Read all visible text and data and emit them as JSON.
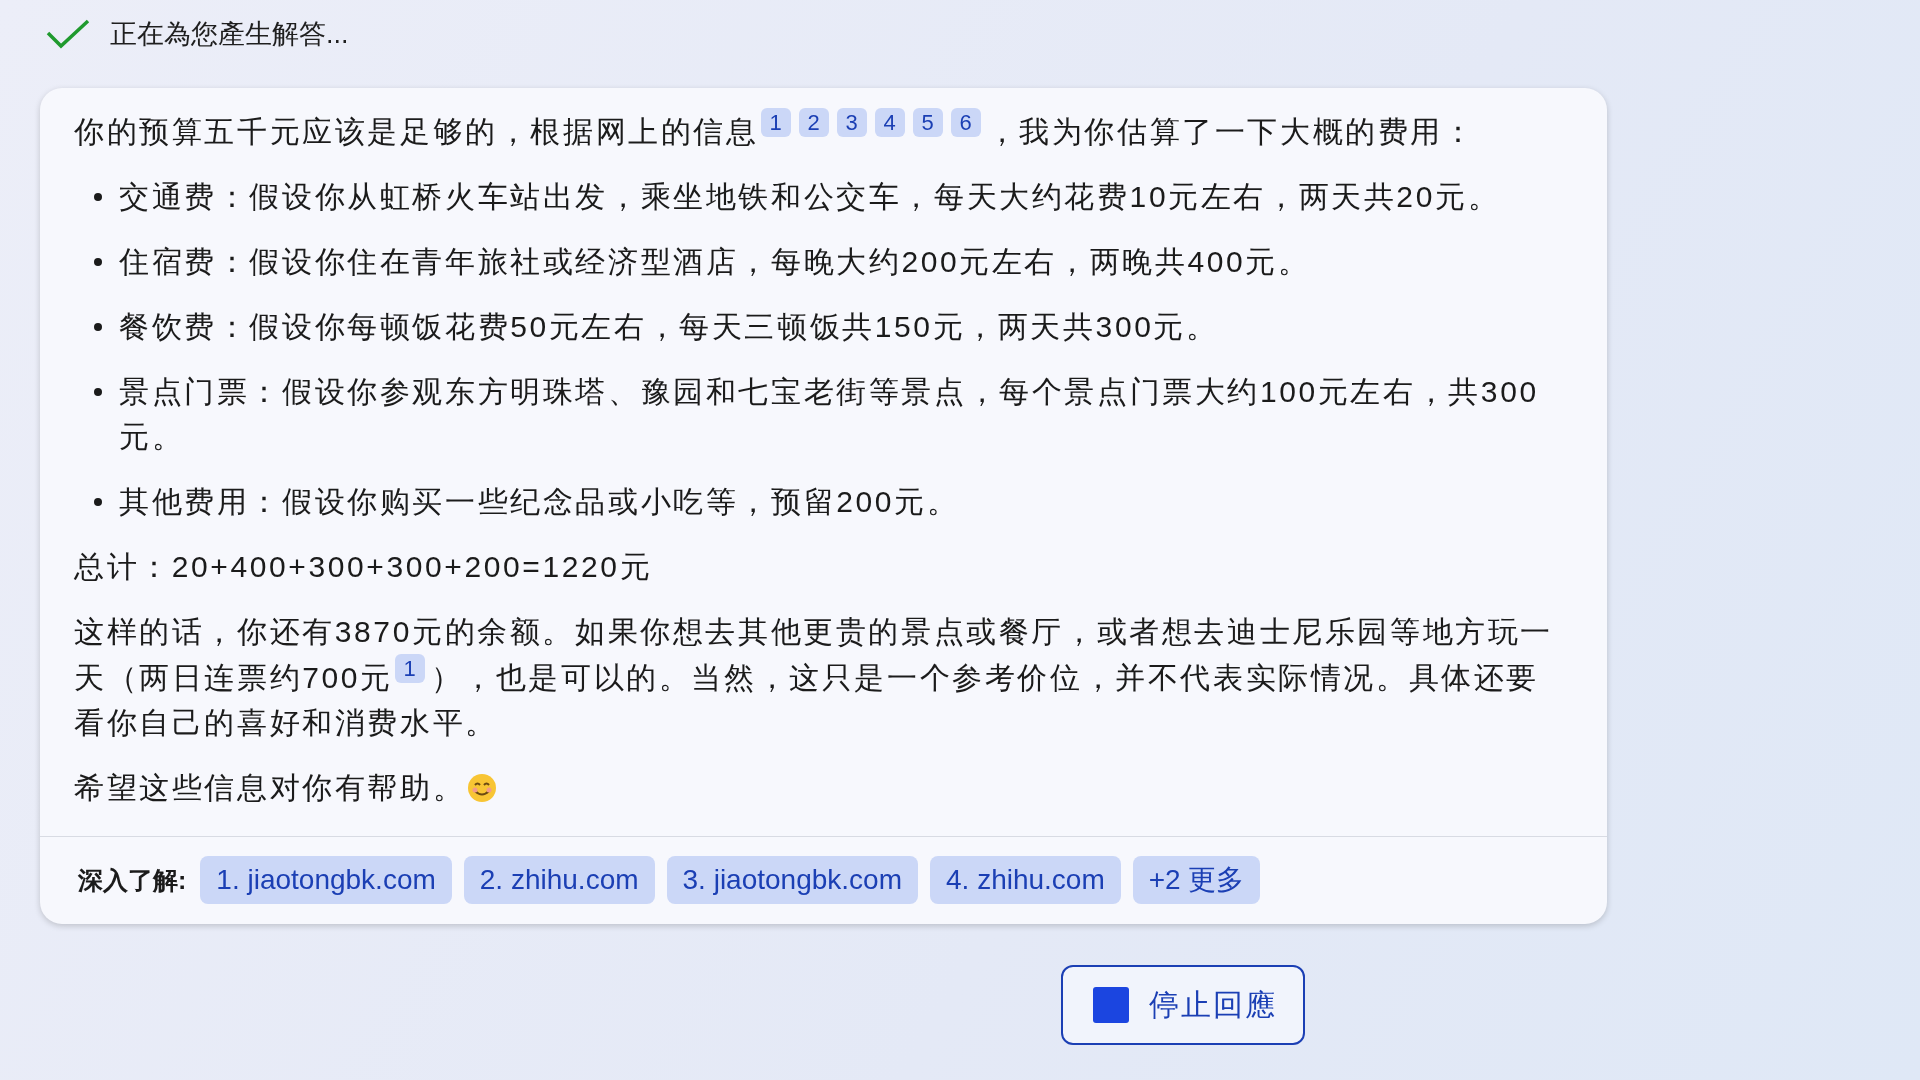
{
  "status": {
    "text": "正在為您產生解答...",
    "done": true
  },
  "answer": [
    {
      "kind": "paragraph",
      "parts": [
        {
          "kind": "text",
          "text": "你的预算五千元应该是足够的，根据网上的信息"
        },
        {
          "kind": "cite",
          "text": "1"
        },
        {
          "kind": "cite",
          "text": "2"
        },
        {
          "kind": "cite",
          "text": "3"
        },
        {
          "kind": "cite",
          "text": "4"
        },
        {
          "kind": "cite",
          "text": "5"
        },
        {
          "kind": "cite",
          "text": "6"
        },
        {
          "kind": "text",
          "text": "，我为你估算了一下大概的费用："
        }
      ]
    },
    {
      "kind": "bullets",
      "items": [
        "交通费：假设你从虹桥火车站出发，乘坐地铁和公交车，每天大约花费10元左右，两天共20元。",
        "住宿费：假设你住在青年旅社或经济型酒店，每晚大约200元左右，两晚共400元。",
        "餐饮费：假设你每顿饭花费50元左右，每天三顿饭共150元，两天共300元。",
        "景点门票：假设你参观东方明珠塔、豫园和七宝老街等景点，每个景点门票大约100元左右，共300元。",
        "其他费用：假设你购买一些纪念品或小吃等，预留200元。"
      ]
    },
    {
      "kind": "paragraph",
      "parts": [
        {
          "kind": "text",
          "text": "总计：20+400+300+300+200=1220元"
        }
      ]
    },
    {
      "kind": "paragraph",
      "parts": [
        {
          "kind": "text",
          "text": "这样的话，你还有3870元的余额。如果你想去其他更贵的景点或餐厅，或者想去迪士尼乐园等地方玩一天（两日连票约700元"
        },
        {
          "kind": "cite",
          "text": "1"
        },
        {
          "kind": "text",
          "text": "），也是可以的。当然，这只是一个参考价位，并不代表实际情况。具体还要看你自己的喜好和消费水平。"
        }
      ]
    },
    {
      "kind": "paragraph",
      "parts": [
        {
          "kind": "text",
          "text": "希望这些信息对你有帮助。"
        },
        {
          "kind": "smiley"
        }
      ]
    }
  ],
  "learn_more": {
    "label": "深入了解:",
    "links": [
      "1. jiaotongbk.com",
      "2. zhihu.com",
      "3. jiaotongbk.com",
      "4. zhihu.com",
      "+2 更多"
    ]
  },
  "stop_button": {
    "label": "停止回應"
  }
}
